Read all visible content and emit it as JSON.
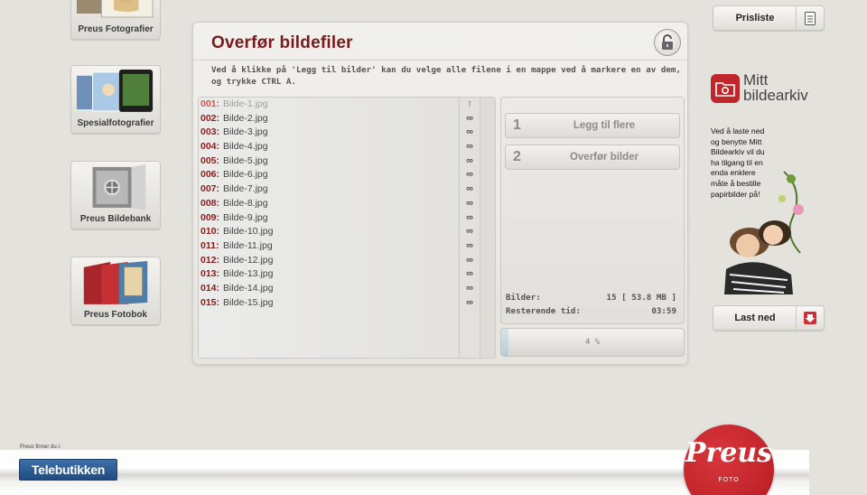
{
  "nav": {
    "tiles": [
      {
        "label": "Preus Fotografier"
      },
      {
        "label": "Spesialfotografier"
      },
      {
        "label": "Preus Bildebank"
      },
      {
        "label": "Preus Fotobok"
      }
    ]
  },
  "panel": {
    "title": "Overfør bildefiler",
    "instructions": "Ved å klikke på 'Legg til bilder' kan du velge alle filene i en mappe ved å markere en av dem, og trykke CTRL A.",
    "files": [
      {
        "num": "001:",
        "name": "Bilde-1.jpg",
        "status": "⇑",
        "uploading": true
      },
      {
        "num": "002:",
        "name": "Bilde-2.jpg",
        "status": "∞"
      },
      {
        "num": "003:",
        "name": "Bilde-3.jpg",
        "status": "∞"
      },
      {
        "num": "004:",
        "name": "Bilde-4.jpg",
        "status": "∞"
      },
      {
        "num": "005:",
        "name": "Bilde-5.jpg",
        "status": "∞"
      },
      {
        "num": "006:",
        "name": "Bilde-6.jpg",
        "status": "∞"
      },
      {
        "num": "007:",
        "name": "Bilde-7.jpg",
        "status": "∞"
      },
      {
        "num": "008:",
        "name": "Bilde-8.jpg",
        "status": "∞"
      },
      {
        "num": "009:",
        "name": "Bilde-9.jpg",
        "status": "∞"
      },
      {
        "num": "010:",
        "name": "Bilde-10.jpg",
        "status": "∞"
      },
      {
        "num": "011:",
        "name": "Bilde-11.jpg",
        "status": "∞"
      },
      {
        "num": "012:",
        "name": "Bilde-12.jpg",
        "status": "∞"
      },
      {
        "num": "013:",
        "name": "Bilde-13.jpg",
        "status": "∞"
      },
      {
        "num": "014:",
        "name": "Bilde-14.jpg",
        "status": "∞"
      },
      {
        "num": "015:",
        "name": "Bilde-15.jpg",
        "status": "∞"
      }
    ],
    "steps": [
      {
        "num": "1",
        "label": "Legg til flere"
      },
      {
        "num": "2",
        "label": "Overfør bilder"
      }
    ],
    "stats": {
      "images_label": "Bilder:",
      "images_value": "15 [ 53.8 MB ]",
      "remaining_label": "Resterende tid:",
      "remaining_value": "03:59"
    },
    "progress": {
      "percent": 4,
      "label": "4 %"
    }
  },
  "side": {
    "price_list_label": "Prisliste",
    "archive_logo_line1": "Mitt",
    "archive_logo_line2": "bildearkiv",
    "promo_text": "Ved å laste ned og benytte Mitt Bildearkiv vil du ha tilgang til en enda enklere måte å bestille papirbilder på!",
    "download_label": "Last ned"
  },
  "footer": {
    "note": "Preus finner du i:",
    "telebutikken_label": "Telebutikken",
    "logo_script": "Preus",
    "logo_sub": "FOTO"
  },
  "colors": {
    "brand_red": "#c0272d",
    "title_red": "#7a1a1a",
    "telebutikken_blue": "#1f4c82"
  }
}
